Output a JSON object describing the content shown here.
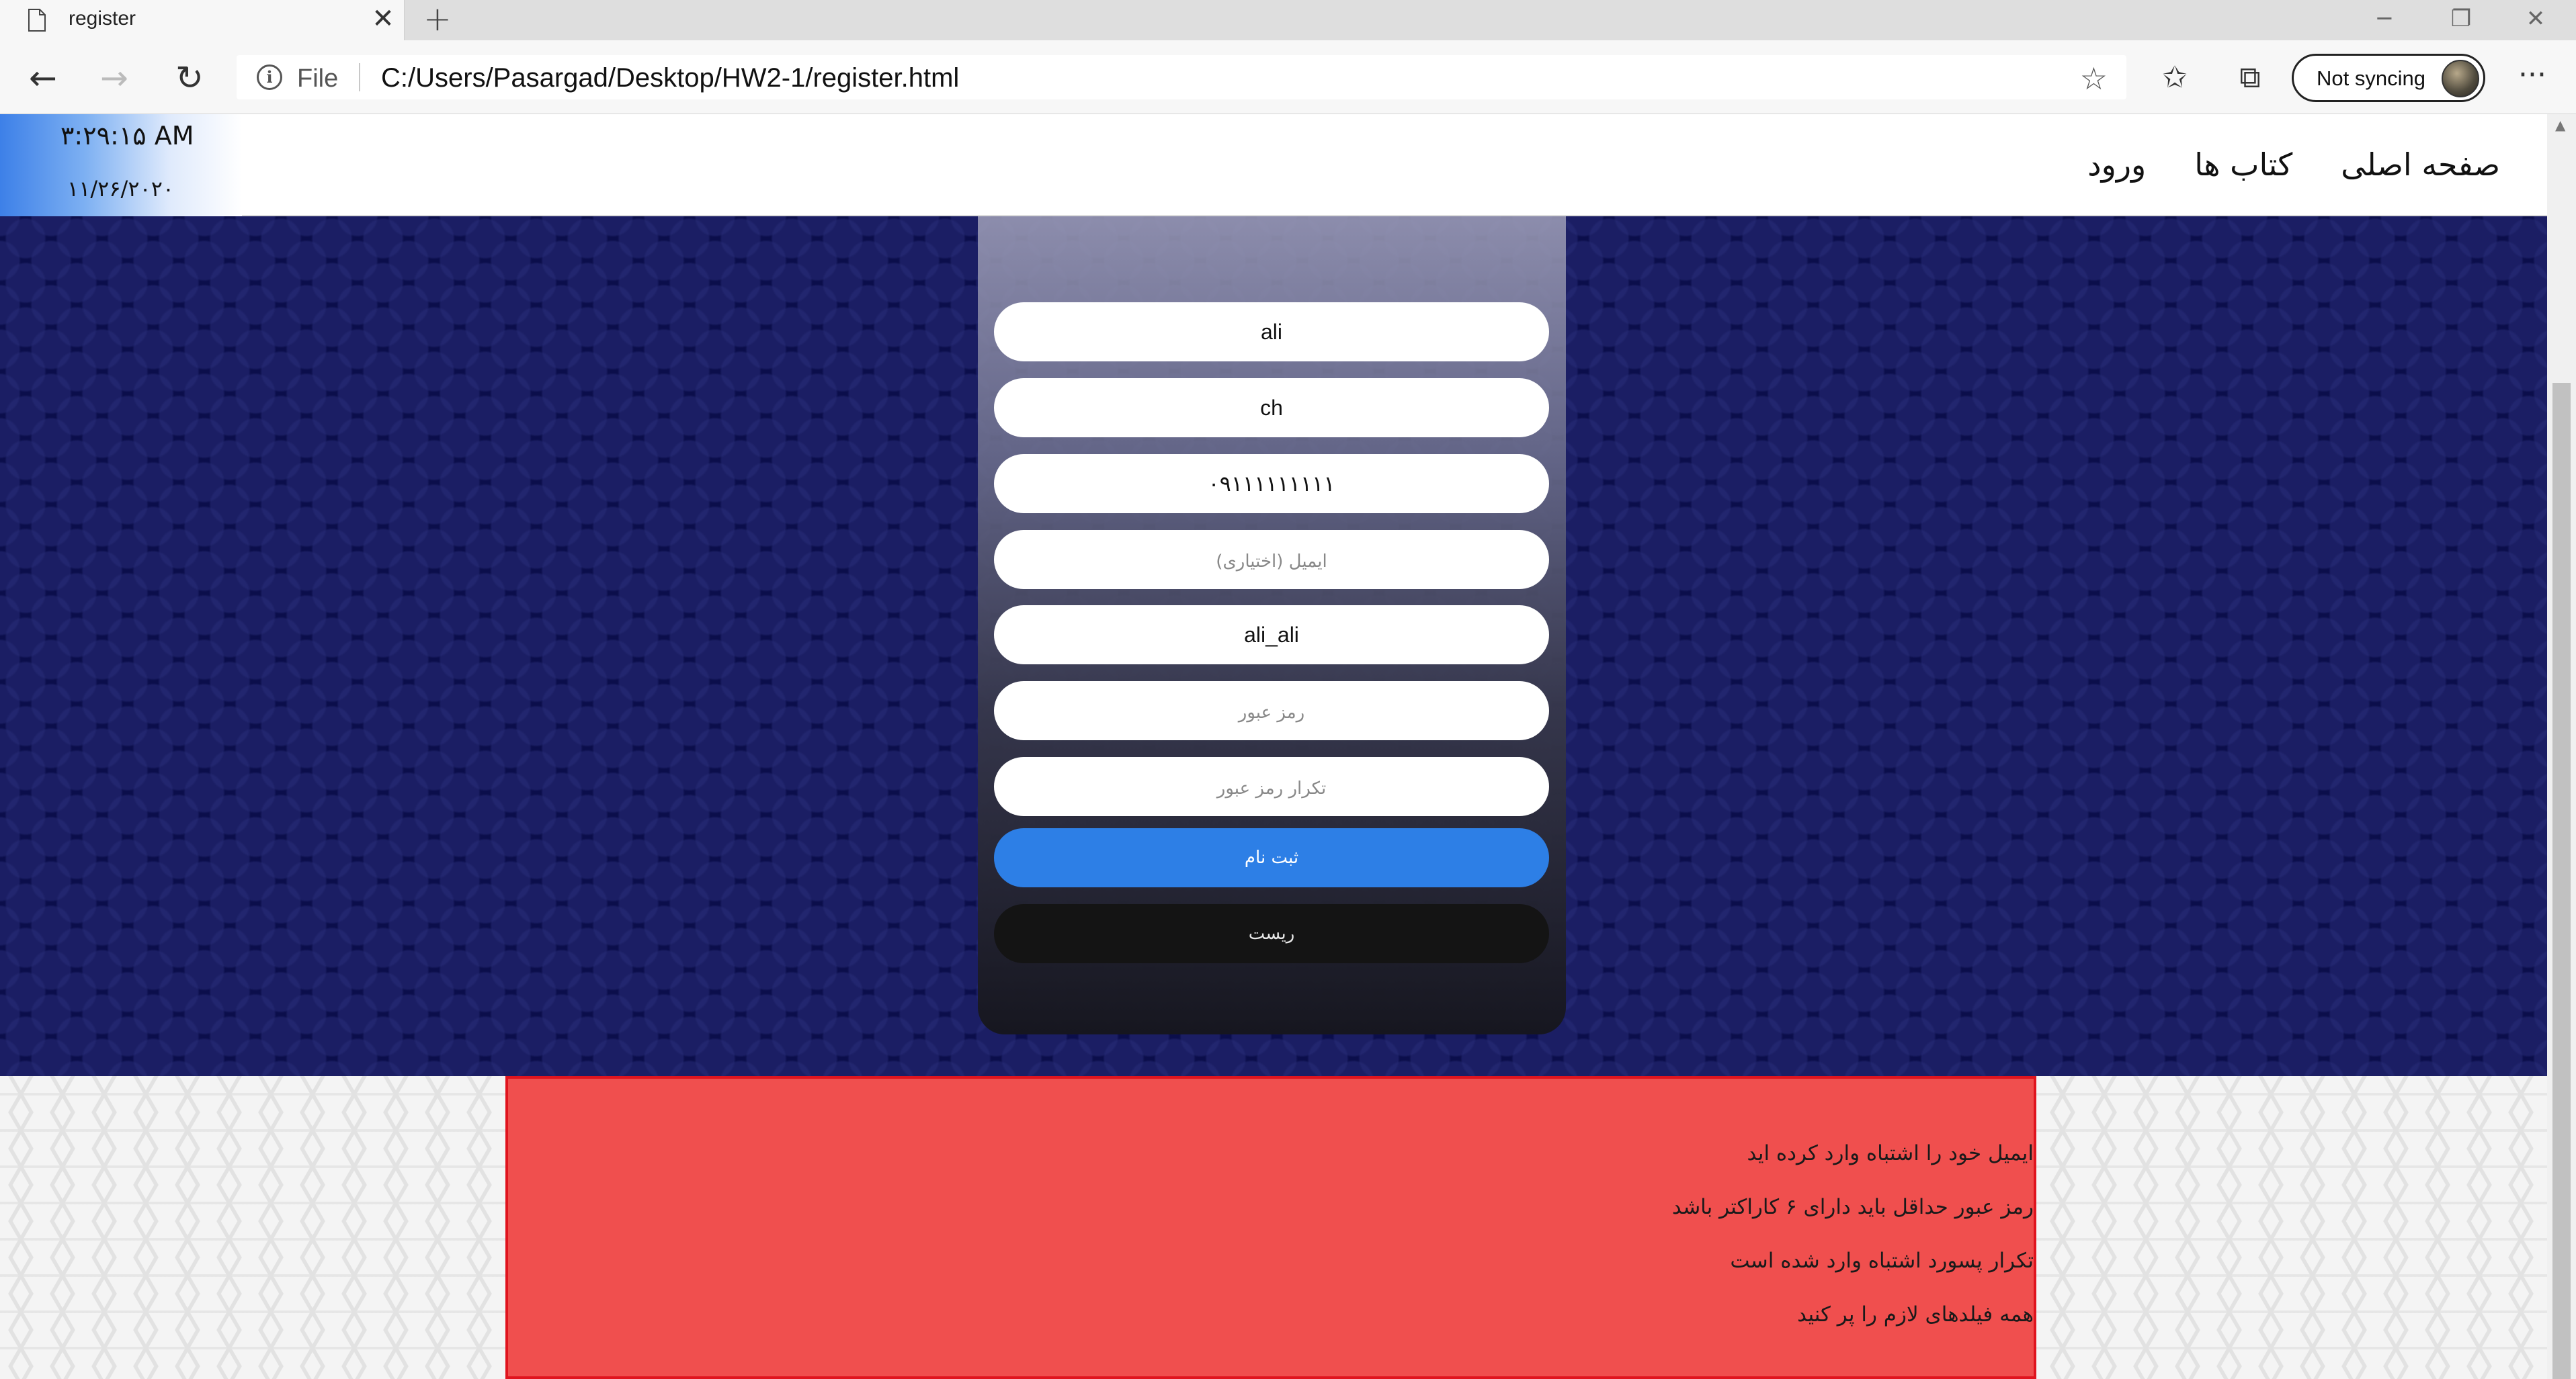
{
  "browser": {
    "tab_title": "register",
    "tab_close": "✕",
    "new_tab": "+",
    "window_controls": {
      "minimize": "─",
      "restore": "❐",
      "close": "✕"
    },
    "nav": {
      "back": "←",
      "forward": "→",
      "refresh": "↻"
    },
    "address": {
      "info": "i",
      "scheme": "File",
      "url": "C:/Users/Pasargad/Desktop/HW2-1/register.html"
    },
    "favorite_icon": "☆",
    "favorites_icon": "✩",
    "collections_icon": "⧉",
    "sync_label": "Not syncing",
    "more": "···"
  },
  "header": {
    "clock_time": "۳:۲۹:۱۵ AM",
    "clock_date": "۱۱/۲۶/۲۰۲۰",
    "nav_links": [
      "صفحه اصلی",
      "کتاب ها",
      "ورود"
    ]
  },
  "form": {
    "fields": [
      {
        "value": "ali",
        "placeholder": ""
      },
      {
        "value": "ch",
        "placeholder": ""
      },
      {
        "value": "۰۹۱۱۱۱۱۱۱۱۱",
        "placeholder": ""
      },
      {
        "value": "",
        "placeholder": "ایمیل (اختیاری)"
      },
      {
        "value": "ali_ali",
        "placeholder": ""
      },
      {
        "value": "",
        "placeholder": "رمز عبور"
      },
      {
        "value": "",
        "placeholder": "تکرار رمز عبور"
      }
    ],
    "submit_label": "ثبت نام",
    "reset_label": "ریست"
  },
  "errors": [
    "ایمیل خود را اشتباه وارد کرده اید",
    "رمز عبور حداقل باید دارای ۶ کاراکتر باشد",
    "تکرار پسورد اشتباه وارد شده است",
    "همه فیلدهای لازم را پر کنید"
  ],
  "colors": {
    "hero_bg": "#0b0e4b",
    "submit_bg": "#2d7fe6",
    "reset_bg": "#141414",
    "error_bg": "#f04f4e",
    "error_border": "#e0141e"
  }
}
